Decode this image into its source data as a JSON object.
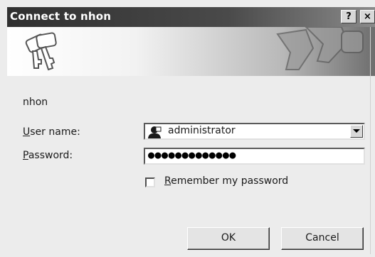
{
  "window": {
    "title": "Connect to nhon",
    "help_label": "?",
    "close_label": "×"
  },
  "form": {
    "server_name": "nhon",
    "username_label_key": "U",
    "username_label_rest": "ser name:",
    "username_value": "administrator",
    "password_label_key": "P",
    "password_label_rest": "assword:",
    "password_masked": "●●●●●●●●●●●●●",
    "remember_key": "R",
    "remember_rest": "emember my password",
    "remember_checked": false
  },
  "buttons": {
    "ok_label": "OK",
    "cancel_label": "Cancel"
  },
  "icons": {
    "banner": "keys-icon",
    "user": "user-icon",
    "dropdown": "chevron-down-icon"
  }
}
